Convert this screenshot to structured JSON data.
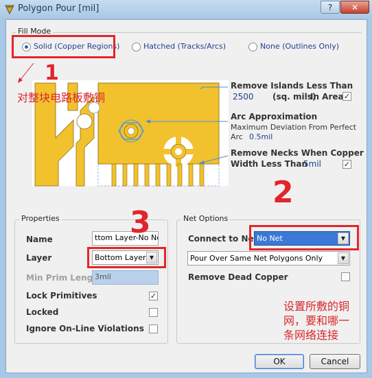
{
  "window": {
    "title": "Polygon Pour [mil]",
    "help_glyph": "?",
    "close_glyph": "✕"
  },
  "fill_mode": {
    "group_label": "Fill Mode",
    "options": [
      {
        "label": "Solid (Copper Regions)",
        "selected": true
      },
      {
        "label": "Hatched (Tracks/Arcs)",
        "selected": false
      },
      {
        "label": "None (Outlines Only)",
        "selected": false
      }
    ]
  },
  "islands": {
    "heading": "Remove Islands Less Than",
    "value": "2500",
    "unit": "(sq. mils)",
    "suffix": "In Area",
    "checked": true
  },
  "arc": {
    "heading": "Arc Approximation",
    "line1": "Maximum Deviation From Perfect",
    "prefix": "Arc",
    "value": "0.5mil"
  },
  "necks": {
    "line1": "Remove Necks When Copper",
    "line2": "Width Less Than",
    "value": "5mil",
    "checked": true
  },
  "properties": {
    "group_label": "Properties",
    "name_label": "Name",
    "name_value": "ttom Layer-No Net",
    "layer_label": "Layer",
    "layer_value": "Bottom Layer",
    "min_prim_label": "Min Prim Length",
    "min_prim_value": "3mil",
    "lock_label": "Lock Primitives",
    "lock_checked": true,
    "locked_label": "Locked",
    "locked_checked": false,
    "ignore_label": "Ignore On-Line Violations",
    "ignore_checked": false
  },
  "net_options": {
    "group_label": "Net Options",
    "connect_label": "Connect to Net",
    "connect_value": "No Net",
    "pour_value": "Pour Over Same Net Polygons Only",
    "dead_label": "Remove Dead Copper",
    "dead_checked": false
  },
  "annotations": {
    "num1": "1",
    "num2": "2",
    "num3": "3",
    "note1": "对整块电路板敷铜",
    "note2_line1": "设置所敷的铜",
    "note2_line2": "网，要和哪一",
    "note2_line3": "条网络连接"
  },
  "buttons": {
    "ok": "OK",
    "cancel": "Cancel"
  },
  "colors": {
    "copper": "#f2c12e",
    "annotation_red": "#e2262a",
    "selection": "#3b78d8"
  }
}
